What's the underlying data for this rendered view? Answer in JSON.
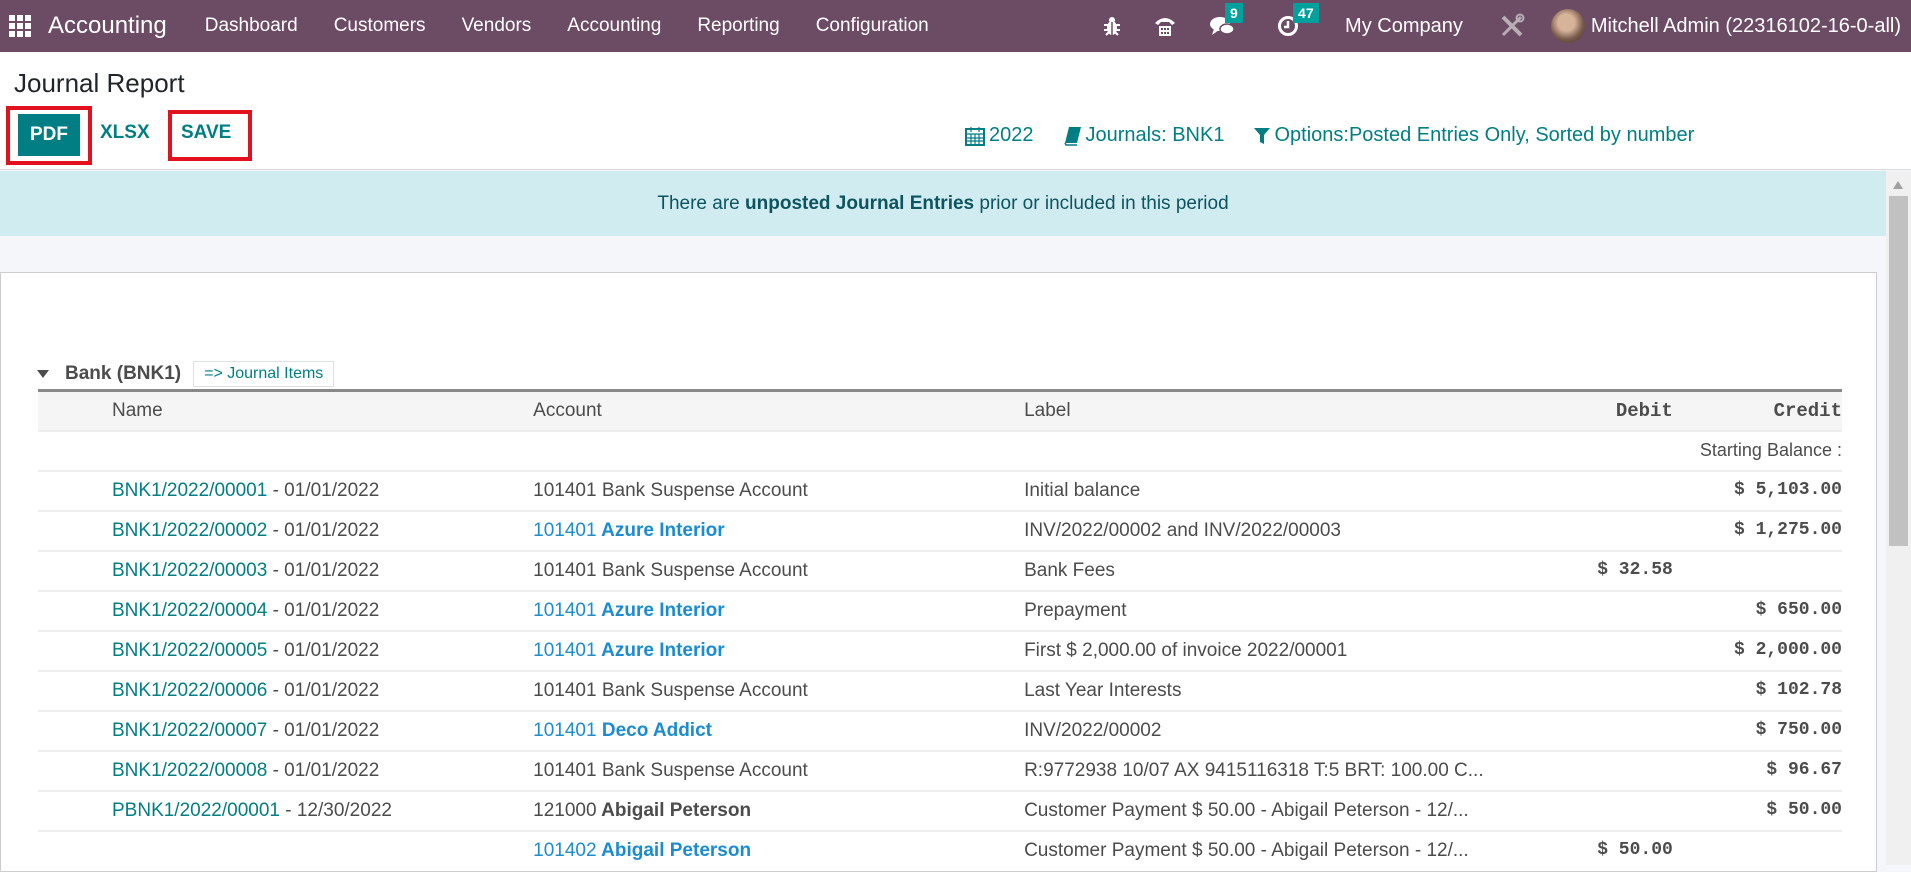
{
  "navbar": {
    "app_name": "Accounting",
    "menu": [
      "Dashboard",
      "Customers",
      "Vendors",
      "Accounting",
      "Reporting",
      "Configuration"
    ],
    "messages_count": "9",
    "activities_count": "47",
    "company": "My Company",
    "user": "Mitchell Admin (22316102-16-0-all)"
  },
  "page": {
    "title": "Journal Report",
    "buttons": {
      "pdf": "PDF",
      "xlsx": "XLSX",
      "save": "SAVE"
    },
    "filters": {
      "date": "2022",
      "journals": "Journals: BNK1",
      "options": "Options:Posted Entries Only, Sorted by number"
    }
  },
  "banner": {
    "prefix": "There are ",
    "bold": "unposted Journal Entries",
    "suffix": " prior or included in this period"
  },
  "report": {
    "group_title": "Bank (BNK1)",
    "journal_items_link": "=> Journal Items",
    "columns": {
      "name": "Name",
      "account": "Account",
      "label": "Label",
      "debit": "Debit",
      "credit": "Credit"
    },
    "starting_balance_label": "Starting Balance :",
    "rows": [
      {
        "move": "BNK1/2022/00001",
        "date": " - 01/01/2022",
        "acct_code": "101401",
        "acct_name": " Bank Suspense Account",
        "acct_style": "plain",
        "label": "Initial balance",
        "debit": "",
        "credit": "$ 5,103.00"
      },
      {
        "move": "BNK1/2022/00002",
        "date": " - 01/01/2022",
        "acct_code": "101401",
        "acct_name": " Azure Interior",
        "acct_style": "link",
        "label": "INV/2022/00002 and INV/2022/00003",
        "debit": "",
        "credit": "$ 1,275.00"
      },
      {
        "move": "BNK1/2022/00003",
        "date": " - 01/01/2022",
        "acct_code": "101401",
        "acct_name": " Bank Suspense Account",
        "acct_style": "plain",
        "label": "Bank Fees",
        "debit": "$ 32.58",
        "credit": ""
      },
      {
        "move": "BNK1/2022/00004",
        "date": " - 01/01/2022",
        "acct_code": "101401",
        "acct_name": " Azure Interior",
        "acct_style": "link",
        "label": "Prepayment",
        "debit": "",
        "credit": "$ 650.00"
      },
      {
        "move": "BNK1/2022/00005",
        "date": " - 01/01/2022",
        "acct_code": "101401",
        "acct_name": " Azure Interior",
        "acct_style": "link",
        "label": "First $ 2,000.00 of invoice 2022/00001",
        "debit": "",
        "credit": "$ 2,000.00"
      },
      {
        "move": "BNK1/2022/00006",
        "date": " - 01/01/2022",
        "acct_code": "101401",
        "acct_name": " Bank Suspense Account",
        "acct_style": "plain",
        "label": "Last Year Interests",
        "debit": "",
        "credit": "$ 102.78"
      },
      {
        "move": "BNK1/2022/00007",
        "date": " - 01/01/2022",
        "acct_code": "101401",
        "acct_name": " Deco Addict",
        "acct_style": "link",
        "label": "INV/2022/00002",
        "debit": "",
        "credit": "$ 750.00"
      },
      {
        "move": "BNK1/2022/00008",
        "date": " - 01/01/2022",
        "acct_code": "101401",
        "acct_name": " Bank Suspense Account",
        "acct_style": "plain",
        "label": "R:9772938 10/07 AX 9415116318 T:5 BRT: 100.00 C...",
        "debit": "",
        "credit": "$ 96.67"
      },
      {
        "move": "PBNK1/2022/00001",
        "date": " - 12/30/2022",
        "acct_code": "121000",
        "acct_name": " Abigail Peterson",
        "acct_style": "bold",
        "label": "Customer Payment $ 50.00 - Abigail Peterson - 12/...",
        "debit": "",
        "credit": "$ 50.00"
      },
      {
        "move": "",
        "date": "",
        "acct_code": "101402",
        "acct_name": " Abigail Peterson",
        "acct_style": "link",
        "label": "Customer Payment $ 50.00 - Abigail Peterson - 12/...",
        "debit": "$ 50.00",
        "credit": ""
      }
    ]
  },
  "colors": {
    "navbar": "#6c4b65",
    "primary": "#017e84",
    "link": "#1b8ccf",
    "banner_bg": "#d1ecf1",
    "highlight": "#e3101e"
  }
}
